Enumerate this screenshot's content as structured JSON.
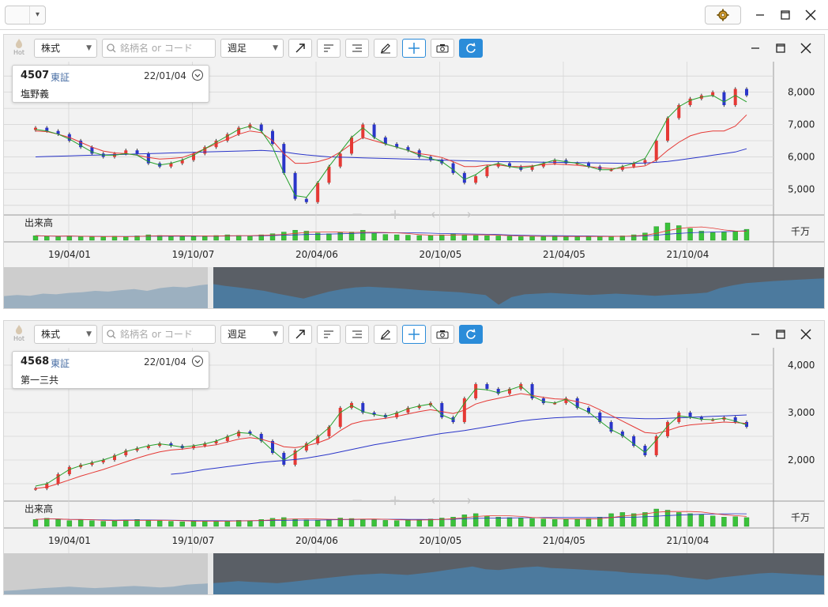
{
  "app": {
    "add_label": "+",
    "icons": {
      "add": "plus-icon",
      "settings": "gear-icon",
      "minimize": "minimize-icon",
      "maximize": "maximize-icon",
      "close": "close-icon"
    }
  },
  "toolbar": {
    "type_value": "株式",
    "search_placeholder": "銘柄名 or コード",
    "period_value": "週足",
    "hot_label": "Hot",
    "tools": [
      "trend-line-icon",
      "align-left-icon",
      "align-right-icon",
      "pencil-icon",
      "crosshair-icon",
      "camera-icon",
      "refresh-icon"
    ]
  },
  "panels": [
    {
      "code": "4507",
      "market": "東証",
      "date": "22/01/04",
      "name": "塩野義",
      "volume_label": "出来高",
      "volume_unit": "千万",
      "x_labels": [
        "19/04/01",
        "19/10/07",
        "20/04/06",
        "20/10/05",
        "21/04/05",
        "21/10/04"
      ],
      "y_labels": [
        "8,000",
        "7,000",
        "6,000",
        "5,000"
      ],
      "chart_data": {
        "type": "candlestick",
        "x_labels": [
          "19/04/01",
          "19/10/07",
          "20/04/06",
          "20/10/05",
          "21/04/05",
          "21/10/04"
        ],
        "ylim": [
          4300,
          8700
        ],
        "y_ticks": [
          5000,
          6000,
          7000,
          8000
        ],
        "close": [
          6900,
          6800,
          6700,
          6500,
          6300,
          6100,
          6000,
          6100,
          6200,
          6100,
          5800,
          5700,
          5800,
          5900,
          6100,
          6300,
          6500,
          6700,
          6900,
          7000,
          6800,
          6400,
          5500,
          4700,
          4600,
          5200,
          5700,
          6100,
          6600,
          7000,
          6600,
          6400,
          6300,
          6200,
          6000,
          5900,
          5800,
          5500,
          5200,
          5400,
          5700,
          5800,
          5700,
          5600,
          5700,
          5800,
          5900,
          5800,
          5800,
          5700,
          5600,
          5600,
          5700,
          5800,
          5900,
          6500,
          7200,
          7600,
          7800,
          7900,
          8000,
          7600,
          8100,
          7900
        ],
        "ma_short": [
          6850,
          6800,
          6700,
          6550,
          6350,
          6150,
          6050,
          6050,
          6100,
          6050,
          5850,
          5750,
          5800,
          5900,
          6050,
          6250,
          6450,
          6650,
          6850,
          6950,
          6800,
          6300,
          5500,
          4800,
          4750,
          5200,
          5700,
          6150,
          6600,
          6900,
          6600,
          6400,
          6300,
          6200,
          6050,
          5950,
          5850,
          5600,
          5300,
          5450,
          5700,
          5800,
          5700,
          5650,
          5700,
          5800,
          5900,
          5850,
          5800,
          5700,
          5600,
          5600,
          5700,
          5800,
          5950,
          6550,
          7200,
          7550,
          7750,
          7850,
          7900,
          7700,
          7900,
          7700
        ],
        "ma_mid": [
          6800,
          6780,
          6700,
          6600,
          6450,
          6300,
          6180,
          6120,
          6100,
          6050,
          5980,
          5930,
          5950,
          5980,
          6100,
          6250,
          6400,
          6550,
          6700,
          6800,
          6750,
          6500,
          6100,
          5800,
          5800,
          5850,
          5950,
          6150,
          6400,
          6600,
          6500,
          6400,
          6300,
          6200,
          6100,
          6050,
          5980,
          5850,
          5700,
          5700,
          5750,
          5750,
          5700,
          5700,
          5720,
          5760,
          5780,
          5760,
          5740,
          5700,
          5660,
          5640,
          5650,
          5680,
          5720,
          5900,
          6200,
          6450,
          6650,
          6750,
          6800,
          6800,
          6950,
          7300
        ],
        "ma_long": [
          6000,
          6010,
          6020,
          6030,
          6040,
          6050,
          6060,
          6070,
          6080,
          6090,
          6100,
          6110,
          6120,
          6130,
          6140,
          6150,
          6160,
          6170,
          6180,
          6190,
          6200,
          6180,
          6150,
          6100,
          6060,
          6030,
          6000,
          5990,
          5980,
          5970,
          5960,
          5950,
          5940,
          5930,
          5920,
          5910,
          5900,
          5890,
          5880,
          5870,
          5860,
          5855,
          5850,
          5845,
          5840,
          5835,
          5830,
          5825,
          5820,
          5815,
          5810,
          5805,
          5800,
          5800,
          5810,
          5830,
          5860,
          5900,
          5950,
          6000,
          6050,
          6100,
          6150,
          6250
        ],
        "volume": [
          0.25,
          0.22,
          0.2,
          0.24,
          0.2,
          0.18,
          0.2,
          0.22,
          0.2,
          0.24,
          0.3,
          0.26,
          0.22,
          0.2,
          0.22,
          0.24,
          0.26,
          0.3,
          0.26,
          0.22,
          0.3,
          0.36,
          0.45,
          0.55,
          0.5,
          0.4,
          0.36,
          0.42,
          0.45,
          0.55,
          0.4,
          0.32,
          0.3,
          0.28,
          0.26,
          0.25,
          0.3,
          0.36,
          0.3,
          0.26,
          0.25,
          0.24,
          0.22,
          0.2,
          0.22,
          0.2,
          0.22,
          0.2,
          0.2,
          0.22,
          0.2,
          0.22,
          0.24,
          0.3,
          0.4,
          0.75,
          0.95,
          0.8,
          0.65,
          0.5,
          0.42,
          0.45,
          0.5,
          0.6
        ]
      },
      "navigator_data": [
        0.35,
        0.38,
        0.36,
        0.42,
        0.4,
        0.44,
        0.46,
        0.5,
        0.48,
        0.52,
        0.55,
        0.5,
        0.58,
        0.62,
        0.6,
        0.66,
        0.7,
        0.64,
        0.6,
        0.55,
        0.5,
        0.42,
        0.35,
        0.28,
        0.38,
        0.48,
        0.55,
        0.6,
        0.62,
        0.6,
        0.58,
        0.55,
        0.52,
        0.5,
        0.48,
        0.46,
        0.42,
        0.38,
        0.1,
        0.32,
        0.4,
        0.42,
        0.44,
        0.42,
        0.4,
        0.38,
        0.4,
        0.42,
        0.4,
        0.38,
        0.36,
        0.38,
        0.4,
        0.42,
        0.45,
        0.58,
        0.66,
        0.72,
        0.75,
        0.78,
        0.8,
        0.82,
        0.84,
        0.86
      ]
    },
    {
      "code": "4568",
      "market": "東証",
      "date": "22/01/04",
      "name": "第一三共",
      "volume_label": "出来高",
      "volume_unit": "千万",
      "x_labels": [
        "19/04/01",
        "19/10/07",
        "20/04/06",
        "20/10/05",
        "21/04/05",
        "21/10/04"
      ],
      "y_labels": [
        "4,000",
        "3,000",
        "2,000"
      ],
      "chart_data": {
        "type": "candlestick",
        "x_labels": [
          "19/04/01",
          "19/10/07",
          "20/04/06",
          "20/10/05",
          "21/04/05",
          "21/10/04"
        ],
        "ylim": [
          1200,
          4200
        ],
        "y_ticks": [
          2000,
          3000,
          4000
        ],
        "close": [
          1400,
          1500,
          1700,
          1850,
          1900,
          1950,
          2000,
          2100,
          2200,
          2250,
          2300,
          2350,
          2300,
          2250,
          2300,
          2350,
          2400,
          2500,
          2600,
          2550,
          2400,
          2150,
          1900,
          2200,
          2350,
          2500,
          2700,
          3100,
          3200,
          3000,
          2950,
          2900,
          3000,
          3100,
          3150,
          3200,
          2900,
          2800,
          3300,
          3600,
          3500,
          3400,
          3500,
          3600,
          3300,
          3200,
          3200,
          3300,
          3100,
          3000,
          2800,
          2600,
          2500,
          2300,
          2100,
          2500,
          2800,
          3000,
          2900,
          2850,
          2850,
          2900,
          2800,
          2700
        ],
        "ma_short": [
          1450,
          1500,
          1650,
          1800,
          1880,
          1940,
          2000,
          2080,
          2180,
          2240,
          2300,
          2340,
          2310,
          2270,
          2300,
          2340,
          2400,
          2490,
          2580,
          2560,
          2420,
          2200,
          2000,
          2150,
          2320,
          2480,
          2680,
          3000,
          3150,
          3020,
          2960,
          2920,
          2990,
          3080,
          3140,
          3180,
          2950,
          2850,
          3200,
          3500,
          3480,
          3420,
          3480,
          3560,
          3350,
          3230,
          3200,
          3280,
          3120,
          3010,
          2820,
          2640,
          2520,
          2340,
          2160,
          2420,
          2720,
          2930,
          2900,
          2860,
          2850,
          2880,
          2820,
          2740
        ],
        "ma_mid": [
          1400,
          1430,
          1500,
          1580,
          1660,
          1730,
          1800,
          1880,
          1960,
          2040,
          2110,
          2170,
          2210,
          2230,
          2260,
          2290,
          2320,
          2380,
          2440,
          2470,
          2440,
          2370,
          2280,
          2260,
          2300,
          2360,
          2450,
          2620,
          2760,
          2820,
          2850,
          2880,
          2920,
          2970,
          3020,
          3060,
          3020,
          2980,
          3050,
          3180,
          3250,
          3300,
          3350,
          3400,
          3360,
          3320,
          3290,
          3280,
          3230,
          3170,
          3060,
          2940,
          2820,
          2700,
          2580,
          2560,
          2620,
          2700,
          2740,
          2760,
          2780,
          2800,
          2790,
          2770
        ],
        "ma_long": [
          null,
          null,
          null,
          null,
          null,
          null,
          null,
          null,
          null,
          null,
          null,
          null,
          1700,
          1720,
          1760,
          1800,
          1830,
          1860,
          1890,
          1920,
          1950,
          1970,
          1990,
          2010,
          2040,
          2080,
          2120,
          2170,
          2220,
          2270,
          2320,
          2360,
          2400,
          2440,
          2480,
          2520,
          2560,
          2590,
          2620,
          2660,
          2700,
          2740,
          2780,
          2820,
          2850,
          2870,
          2890,
          2900,
          2910,
          2910,
          2910,
          2900,
          2890,
          2880,
          2870,
          2870,
          2880,
          2890,
          2900,
          2910,
          2920,
          2930,
          2940,
          2950
        ],
        "volume": [
          0.3,
          0.35,
          0.3,
          0.25,
          0.28,
          0.25,
          0.22,
          0.24,
          0.28,
          0.3,
          0.26,
          0.24,
          0.22,
          0.2,
          0.22,
          0.24,
          0.22,
          0.24,
          0.26,
          0.25,
          0.3,
          0.35,
          0.38,
          0.32,
          0.28,
          0.26,
          0.3,
          0.36,
          0.34,
          0.3,
          0.28,
          0.26,
          0.25,
          0.28,
          0.3,
          0.32,
          0.36,
          0.4,
          0.5,
          0.55,
          0.45,
          0.4,
          0.38,
          0.36,
          0.34,
          0.32,
          0.3,
          0.3,
          0.32,
          0.34,
          0.4,
          0.55,
          0.6,
          0.55,
          0.6,
          0.75,
          0.7,
          0.6,
          0.55,
          0.5,
          0.45,
          0.4,
          0.42,
          0.38
        ]
      },
      "navigator_data": [
        0.1,
        0.12,
        0.15,
        0.18,
        0.2,
        0.22,
        0.2,
        0.18,
        0.2,
        0.22,
        0.24,
        0.22,
        0.2,
        0.22,
        0.28,
        0.3,
        0.32,
        0.35,
        0.38,
        0.36,
        0.34,
        0.32,
        0.36,
        0.4,
        0.44,
        0.48,
        0.52,
        0.56,
        0.58,
        0.6,
        0.58,
        0.56,
        0.6,
        0.64,
        0.7,
        0.75,
        0.8,
        0.72,
        0.7,
        0.74,
        0.78,
        0.8,
        0.76,
        0.74,
        0.72,
        0.7,
        0.68,
        0.66,
        0.62,
        0.6,
        0.58,
        0.56,
        0.5,
        0.46,
        0.42,
        0.48,
        0.52,
        0.56,
        0.6,
        0.62,
        0.6,
        0.58,
        0.56,
        0.54
      ]
    }
  ],
  "colors": {
    "up": "#e53935",
    "down": "#2a35c9",
    "ma_short": "#25a02a",
    "ma_mid": "#e53935",
    "ma_long": "#2a35c9",
    "volume": "#3ac23a",
    "accent": "#2b8cd9",
    "grid": "#d6d6d6"
  }
}
